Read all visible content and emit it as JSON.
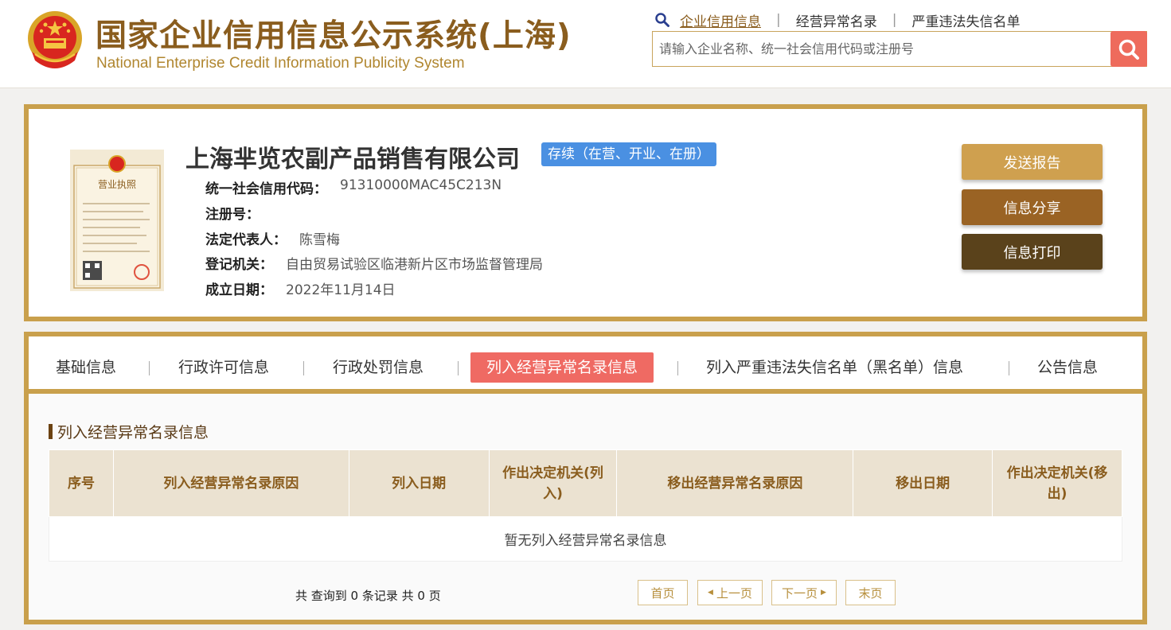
{
  "header": {
    "title": "国家企业信用信息公示系统(上海)",
    "subtitle": "National Enterprise Credit Information Publicity System",
    "nav": [
      {
        "label": "企业信用信息",
        "active": true
      },
      {
        "label": "经营异常名录",
        "active": false
      },
      {
        "label": "严重违法失信名单",
        "active": false
      }
    ],
    "search_placeholder": "请输入企业名称、统一社会信用代码或注册号"
  },
  "company": {
    "license_image_text": "营业执照",
    "name": "上海芈览农副产品销售有限公司",
    "status": "存续（在营、开业、在册）",
    "fields": [
      {
        "label": "统一社会信用代码：",
        "value": "91310000MAC45C213N"
      },
      {
        "label": "注册号：",
        "value": ""
      },
      {
        "label": "法定代表人：",
        "value": "陈雪梅"
      },
      {
        "label": "登记机关：",
        "value": "自由贸易试验区临港新片区市场监督管理局"
      },
      {
        "label": "成立日期：",
        "value": "2022年11月14日"
      }
    ],
    "actions": {
      "send_report": "发送报告",
      "share": "信息分享",
      "print": "信息打印"
    }
  },
  "tabs": [
    {
      "label": "基础信息",
      "active": false
    },
    {
      "label": "行政许可信息",
      "active": false
    },
    {
      "label": "行政处罚信息",
      "active": false
    },
    {
      "label": "列入经营异常名录信息",
      "active": true
    },
    {
      "label": "列入严重违法失信名单（黑名单）信息",
      "active": false
    },
    {
      "label": "公告信息",
      "active": false
    }
  ],
  "section": {
    "title": "列入经营异常名录信息",
    "columns": [
      "序号",
      "列入经营异常名录原因",
      "列入日期",
      "作出决定机关(列入)",
      "移出经营异常名录原因",
      "移出日期",
      "作出决定机关(移出)"
    ],
    "empty_message": "暂无列入经营异常名录信息",
    "pager_summary": "共 查询到 0 条记录 共 0 页",
    "pager": {
      "first": "首页",
      "prev": "上一页",
      "next": "下一页",
      "last": "末页"
    }
  },
  "colors": {
    "brand_gold": "#c9a04c",
    "title_brown": "#8a5d1e",
    "status_blue": "#4a90e2",
    "active_tab": "#ef6a63",
    "btn_send": "#cfa04f",
    "btn_share": "#9a6324",
    "btn_print": "#5a421b"
  }
}
